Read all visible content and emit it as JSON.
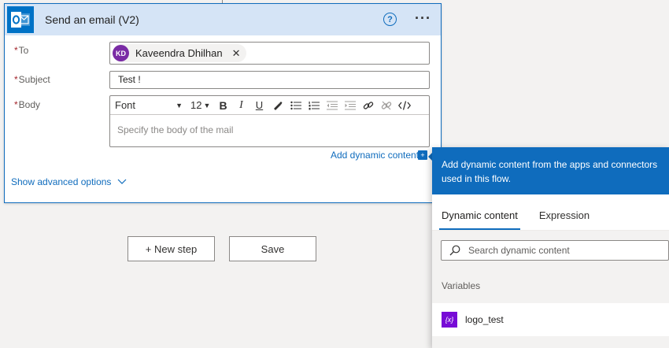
{
  "action": {
    "title": "Send an email (V2)",
    "help_icon": "?",
    "more_icon": "···",
    "required_marker": "*",
    "to": {
      "label": "To",
      "recipient_initials": "KD",
      "recipient_name": "Kaveendra Dhilhan",
      "remove_icon": "✕"
    },
    "subject": {
      "label": "Subject",
      "value": "Test !"
    },
    "body": {
      "label": "Body",
      "font": "Font",
      "font_size": "12",
      "placeholder": "Specify the body of the mail"
    },
    "add_dynamic_content": "Add dynamic content",
    "dynamic_badge": "+",
    "show_advanced": "Show advanced options",
    "accent_color": "#0f6cbd"
  },
  "buttons": {
    "new_step": "+ New step",
    "save": "Save"
  },
  "flyout": {
    "header_text": "Add dynamic content from the apps and connectors used in this flow.",
    "tabs": [
      {
        "label": "Dynamic content",
        "active": true
      },
      {
        "label": "Expression",
        "active": false
      }
    ],
    "search_placeholder": "Search dynamic content",
    "section_title": "Variables",
    "variables": [
      {
        "icon_text": "{x}",
        "label": "logo_test"
      }
    ],
    "header_color": "#0f6cbd",
    "variable_icon_color": "#770bd6"
  }
}
